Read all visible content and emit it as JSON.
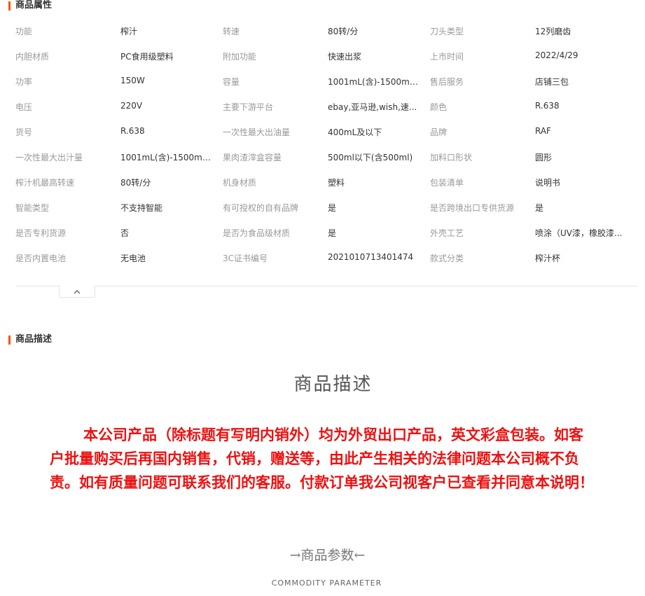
{
  "attributes": {
    "title": "商品属性",
    "rows": [
      [
        [
          "功能",
          "榨汁"
        ],
        [
          "转速",
          "80转/分"
        ],
        [
          "刀头类型",
          "12列磨齿"
        ]
      ],
      [
        [
          "内胆材质",
          "PC食用级塑料"
        ],
        [
          "附加功能",
          "快速出浆"
        ],
        [
          "上市时间",
          "2022/4/29"
        ]
      ],
      [
        [
          "功率",
          "150W"
        ],
        [
          "容量",
          "1001mL(含)-1500mL(..."
        ],
        [
          "售后服务",
          "店铺三包"
        ]
      ],
      [
        [
          "电压",
          "220V"
        ],
        [
          "主要下游平台",
          "ebay,亚马逊,wish,速..."
        ],
        [
          "颜色",
          "R.638"
        ]
      ],
      [
        [
          "货号",
          "R.638"
        ],
        [
          "一次性最大出油量",
          "400mL及以下"
        ],
        [
          "品牌",
          "RAF"
        ]
      ],
      [
        [
          "一次性最大出汁量",
          "1001mL(含)-1500mL(..."
        ],
        [
          "果肉渣滓盒容量",
          "500ml以下(含500ml)"
        ],
        [
          "加料口形状",
          "圆形"
        ]
      ],
      [
        [
          "榨汁机最高转速",
          "80转/分"
        ],
        [
          "机身材质",
          "塑料"
        ],
        [
          "包装清单",
          "说明书"
        ]
      ],
      [
        [
          "智能类型",
          "不支持智能"
        ],
        [
          "有可授权的自有品牌",
          "是"
        ],
        [
          "是否跨境出口专供货源",
          "是"
        ]
      ],
      [
        [
          "是否专利货源",
          "否"
        ],
        [
          "是否为食品级材质",
          "是"
        ],
        [
          "外壳工艺",
          "喷涂（UV漆，橡胶漆..."
        ]
      ],
      [
        [
          "是否内置电池",
          "无电池"
        ],
        [
          "3C证书编号",
          "2021010713401474"
        ],
        [
          "款式分类",
          "榨汁杯"
        ]
      ]
    ],
    "collapse_icon": "chevron-up-icon"
  },
  "description": {
    "title": "商品描述",
    "heading": "商品描述",
    "notice": "本公司产品（除标题有写明内销外）均为外贸出口产品，英文彩盒包装。如客户批量购买后再国内销售，代销，赠送等，由此产生相关的法律问题本公司概不负责。如有质量问题可联系我们的客服。付款订单我公司视客户已查看并同意本说明！",
    "param_heading": "→商品参数←",
    "param_sub": "COMMODITY  PARAMETER"
  },
  "colors": {
    "accent": "#ff5000",
    "notice_text": "#ee1111",
    "key_text": "#999999",
    "value_text": "#333333"
  }
}
